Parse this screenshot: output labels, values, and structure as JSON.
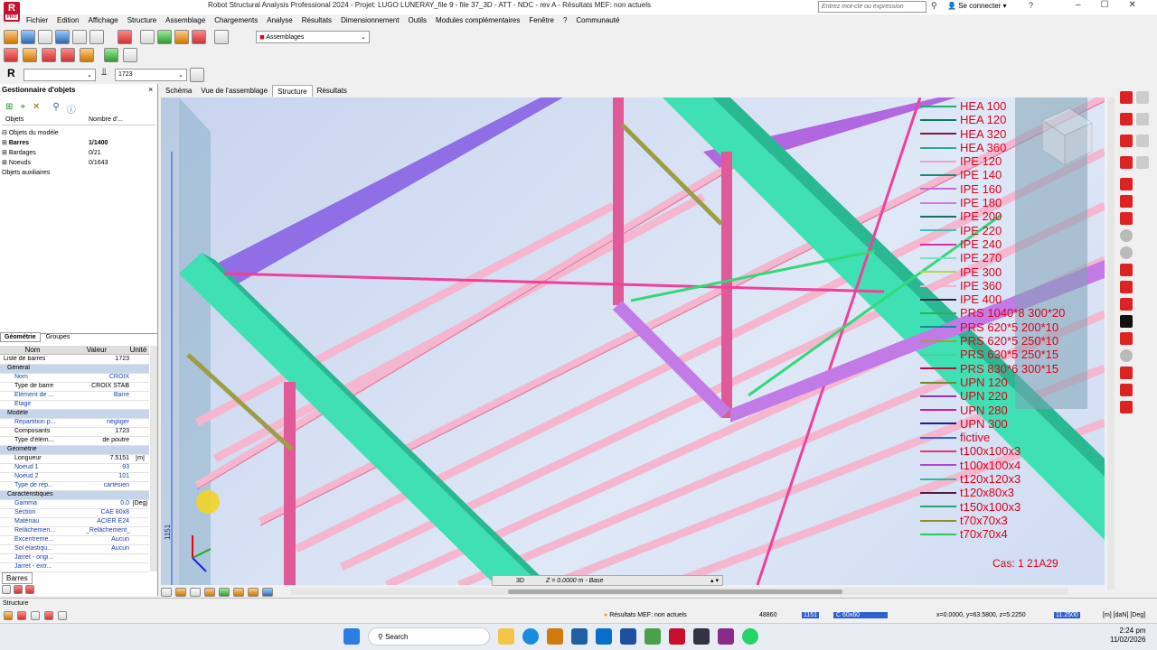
{
  "window": {
    "title": "Robot Structural Analysis Professional 2024 - Projet: LUGO LUNERAY_file 9 - file 37_3D - ATT - NDC - rev A - Résultats MEF: non actuels",
    "logo": "R",
    "logo_sub": "PRO",
    "search_placeholder": "Entrez mot-clé ou expression",
    "sign_in": "Se connecter"
  },
  "menu": [
    "Fichier",
    "Edition",
    "Affichage",
    "Structure",
    "Assemblage",
    "Chargements",
    "Analyse",
    "Résultats",
    "Dimensionnement",
    "Outils",
    "Modules complémentaires",
    "Fenêtre",
    "?",
    "Communauté"
  ],
  "toolbar": {
    "layout_select": "Assemblages",
    "selection_value": "1723"
  },
  "object_manager": {
    "title": "Gestionnaire d'objets",
    "col_objects": "Objets",
    "col_number": "Nombre d'...",
    "tree": [
      {
        "label": "Objets du modèle",
        "count": ""
      },
      {
        "label": "Barres",
        "count": "1/1400"
      },
      {
        "label": "Bardages",
        "count": "0/21"
      },
      {
        "label": "Noeuds",
        "count": "0/1643"
      },
      {
        "label": "Objets auxiliaires",
        "count": ""
      }
    ],
    "tabs": [
      "Géométrie",
      "Groupes"
    ],
    "prop_headers": [
      "Nom",
      "Valeur",
      "Unité"
    ],
    "props": [
      {
        "k": "Liste de barres",
        "v": "1723",
        "u": "",
        "type": "row"
      },
      {
        "k": "Général",
        "v": "",
        "u": "",
        "type": "sec"
      },
      {
        "k": "Nom",
        "v": "CROIX",
        "u": "",
        "type": "blue"
      },
      {
        "k": "Type de barre",
        "v": "CROIX STAB",
        "u": "",
        "type": "row"
      },
      {
        "k": "Elément de ...",
        "v": "Barre",
        "u": "",
        "type": "blue"
      },
      {
        "k": "Etage",
        "v": "",
        "u": "",
        "type": "blue"
      },
      {
        "k": "Modèle",
        "v": "",
        "u": "",
        "type": "sec"
      },
      {
        "k": "Répartition p...",
        "v": "négliger",
        "u": "",
        "type": "blue"
      },
      {
        "k": "Composants",
        "v": "1723",
        "u": "",
        "type": "row"
      },
      {
        "k": "Type d'élém...",
        "v": "de poutre",
        "u": "",
        "type": "row"
      },
      {
        "k": "Géométrie",
        "v": "",
        "u": "",
        "type": "sec"
      },
      {
        "k": "Longueur",
        "v": "7.5151",
        "u": "[m]",
        "type": "row"
      },
      {
        "k": "Noeud 1",
        "v": "93",
        "u": "",
        "type": "blue"
      },
      {
        "k": "Noeud 2",
        "v": "101",
        "u": "",
        "type": "blue"
      },
      {
        "k": "Type de rep...",
        "v": "cartésien",
        "u": "",
        "type": "blue"
      },
      {
        "k": "Caractéristiques",
        "v": "",
        "u": "",
        "type": "sec"
      },
      {
        "k": "Gamma",
        "v": "0.0",
        "u": "[Deg]",
        "type": "blue"
      },
      {
        "k": "Section",
        "v": "CAE 80x8",
        "u": "",
        "type": "blue"
      },
      {
        "k": "Matériau",
        "v": "ACIER E24",
        "u": "",
        "type": "blue"
      },
      {
        "k": "Relâchemen...",
        "v": "_Relâchement_1",
        "u": "",
        "type": "blue"
      },
      {
        "k": "Excentreme...",
        "v": "Aucun",
        "u": "",
        "type": "blue"
      },
      {
        "k": "Sol élastiqu...",
        "v": "Aucun",
        "u": "",
        "type": "blue"
      },
      {
        "k": "Jarret - origi...",
        "v": "",
        "u": "",
        "type": "blue"
      },
      {
        "k": "Jarret - extr...",
        "v": "",
        "u": "",
        "type": "blue"
      }
    ],
    "bottom_tab": "Barres"
  },
  "view_tabs": [
    "Schéma",
    "Vue de l'assemblage",
    "Structure",
    "Résultats"
  ],
  "legend": [
    {
      "label": "HEA 100",
      "color": "#1fae6b"
    },
    {
      "label": "HEA 120",
      "color": "#0b7a5c"
    },
    {
      "label": "HEA 320",
      "color": "#7a1c3c"
    },
    {
      "label": "HEA 360",
      "color": "#2aa98e"
    },
    {
      "label": "IPE 120",
      "color": "#e8a6c7"
    },
    {
      "label": "IPE 140",
      "color": "#1e8a74"
    },
    {
      "label": "IPE 160",
      "color": "#c16bd8"
    },
    {
      "label": "IPE 180",
      "color": "#d37adf"
    },
    {
      "label": "IPE 200",
      "color": "#1f6b62"
    },
    {
      "label": "IPE 220",
      "color": "#3ac4b3"
    },
    {
      "label": "IPE 240",
      "color": "#e02aa6"
    },
    {
      "label": "IPE 270",
      "color": "#7be0c5"
    },
    {
      "label": "IPE 300",
      "color": "#b6d93a"
    },
    {
      "label": "IPE 360",
      "color": "#f2b2d0"
    },
    {
      "label": "IPE 400",
      "color": "#3a1f4d"
    },
    {
      "label": "PRS 1040*8 300*20",
      "color": "#2bb15c"
    },
    {
      "label": "PRS 620*5 200*10",
      "color": "#0e8f9c"
    },
    {
      "label": "PRS 620*5 250*10",
      "color": "#9aa631"
    },
    {
      "label": "PRS 630*5 250*15",
      "color": "#43d39b"
    },
    {
      "label": "PRS 830*6 300*15",
      "color": "#b3123e"
    },
    {
      "label": "UPN 120",
      "color": "#6c8d2a"
    },
    {
      "label": "UPN 220",
      "color": "#8c3aa8"
    },
    {
      "label": "UPN 280",
      "color": "#e60f8c"
    },
    {
      "label": "UPN 300",
      "color": "#1c1c8a"
    },
    {
      "label": "fictive",
      "color": "#2f5fe3"
    },
    {
      "label": "t100x100x3",
      "color": "#e23a6b"
    },
    {
      "label": "t100x100x4",
      "color": "#b541d6"
    },
    {
      "label": "t120x120x3",
      "color": "#2bbca3"
    },
    {
      "label": "t120x80x3",
      "color": "#4a1f3a"
    },
    {
      "label": "t150x100x3",
      "color": "#2e9f7a"
    },
    {
      "label": "t70x70x3",
      "color": "#8f8f2e"
    },
    {
      "label": "t70x70x4",
      "color": "#33c45e"
    }
  ],
  "case_label": "Cas: 1 21A29",
  "axis_label": "1151",
  "view_bar": {
    "mode": "3D",
    "plane": "Z = 0.0000 m - Base"
  },
  "status": {
    "left": "Structure",
    "mef": "Résultats MEF: non actuels",
    "n1": "48860",
    "n2": "1151",
    "section": "C 60x60",
    "coords": "x=0.0000, y=63.5800, z=5.2250",
    "val": "11.2500",
    "units": "[m] [daN] [Deg]"
  },
  "taskbar": {
    "search": "Search",
    "time": "2:24 pm",
    "date": "11/02/2026"
  }
}
